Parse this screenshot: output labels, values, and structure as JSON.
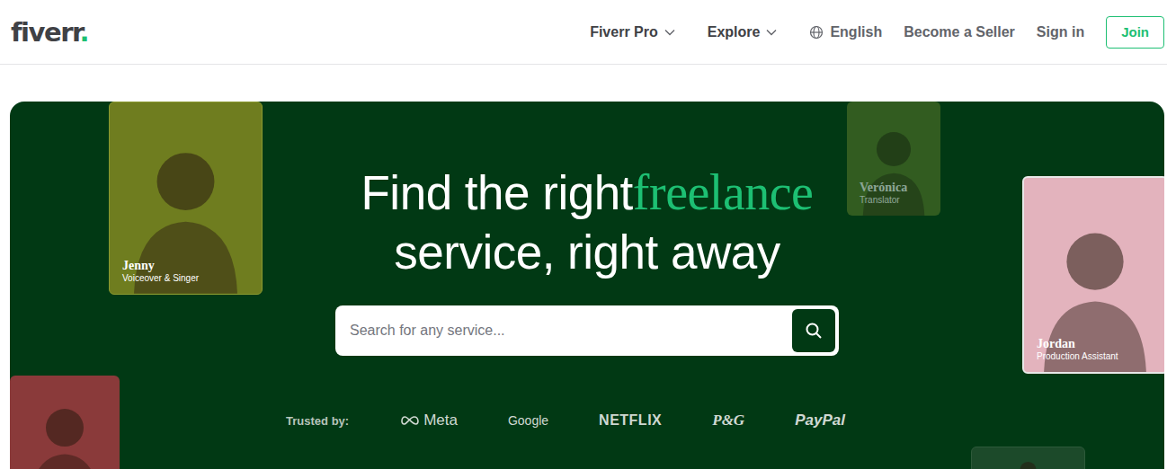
{
  "logo": {
    "text": "fiverr",
    "dot": "."
  },
  "nav": [
    {
      "label": "Fiverr Pro",
      "kind": "dropdown"
    },
    {
      "label": "Explore",
      "kind": "dropdown"
    },
    {
      "label": "English",
      "kind": "language"
    },
    {
      "label": "Become a Seller",
      "kind": "link"
    },
    {
      "label": "Sign in",
      "kind": "link"
    },
    {
      "label": "Join",
      "kind": "button"
    }
  ],
  "hero": {
    "title_before": "Find the right",
    "title_highlight": "freelance",
    "title_after": "service, right away"
  },
  "search": {
    "placeholder": "Search for any service..."
  },
  "trusted": {
    "label": "Trusted by:",
    "brands": [
      {
        "name": "Meta",
        "kind": "icon"
      },
      {
        "name": "Google",
        "kind": "plain"
      },
      {
        "name": "NETFLIX",
        "kind": "bold"
      },
      {
        "name": "P&G",
        "kind": "serif"
      },
      {
        "name": "PayPal",
        "kind": "italic"
      }
    ]
  },
  "freelancers": [
    {
      "name": "Jenny",
      "role": "Voiceover & Singer",
      "color": "#6f7d1f"
    },
    {
      "name": "Verónica",
      "role": "Translator",
      "color": "#5a7a2a"
    },
    {
      "name": "Jordan",
      "role": "Production Assistant",
      "color": "#e3b3bd"
    },
    {
      "name": "",
      "role": "",
      "color": "#8a3a3a"
    },
    {
      "name": "",
      "role": "",
      "color": "#1c4a2a"
    }
  ]
}
